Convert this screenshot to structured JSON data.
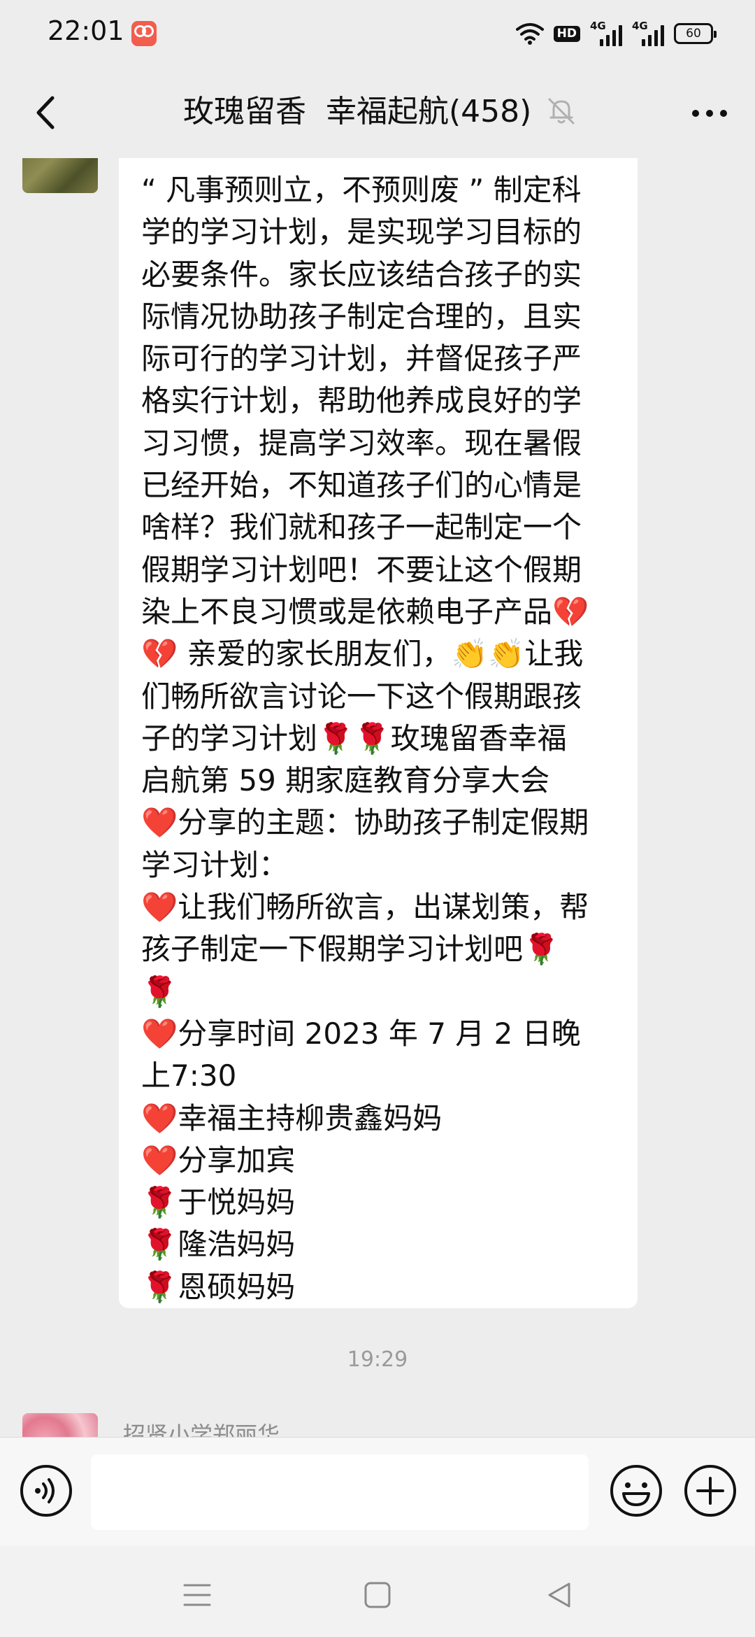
{
  "status_bar": {
    "time": "22:01",
    "hd_label": "HD",
    "network_1": "4G",
    "network_2": "4G",
    "battery": "60"
  },
  "header": {
    "title": "玫瑰留香  幸福起航(458)"
  },
  "message": {
    "lines": [
      "“ 凡事预则立，不预则废 ” 制定科",
      "学的学习计划，是实现学习目标的",
      "必要条件。家长应该结合孩子的实",
      "际情况协助孩子制定合理的，且实",
      "际可行的学习计划，并督促孩子严",
      "格实行计划，帮助他养成良好的学",
      "习习惯，提高学习效率。现在暑假",
      "已经开始，不知道孩子们的心情是",
      "啥样？我们就和孩子一起制定一个",
      "假期学习计划吧！不要让这个假期",
      "染上不良习惯或是依赖电子产品💔",
      "💔 亲爱的家长朋友们，👏👏让我",
      "们畅所欲言讨论一下这个假期跟孩",
      "子的学习计划🌹🌹玫瑰留香幸福",
      "启航第 59 期家庭教育分享大会",
      "❤️分享的主题：协助孩子制定假期",
      "学习计划：",
      "❤️让我们畅所欲言，出谋划策，帮",
      "孩子制定一下假期学习计划吧🌹",
      "🌹",
      "❤️分享时间 2023 年 7 月 2 日晚",
      "上7:30",
      "❤️幸福主持柳贵鑫妈妈",
      "❤️分享加宾",
      "🌹于悦妈妈",
      "🌹隆浩妈妈",
      "🌹恩硕妈妈"
    ]
  },
  "timestamp": "19:29",
  "next_message": {
    "sender": "招贤小学郑丽华"
  },
  "input": {
    "value": "",
    "placeholder": ""
  },
  "icons": {
    "back": "chevron-left-icon",
    "mute": "bell-muted-icon",
    "more": "more-dots-icon",
    "voice": "voice-icon",
    "emoji": "smiley-icon",
    "plus": "plus-icon",
    "menu": "menu-icon",
    "home": "home-square-icon",
    "sys_back": "triangle-back-icon"
  }
}
